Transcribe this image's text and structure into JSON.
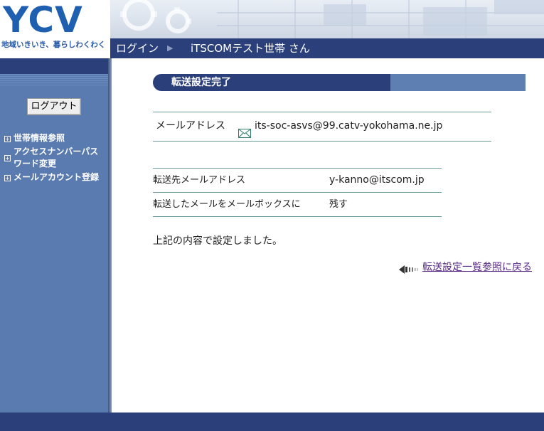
{
  "header": {
    "logo": "YCV",
    "tagline": "地域いきいき、暮らしわくわく",
    "login_label": "ログイン",
    "user_label": "iTSCOMテスト世帯 さん"
  },
  "sidebar": {
    "logout_label": "ログアウト",
    "items": [
      {
        "label": "世帯情報参照",
        "icon": "expand-box-icon"
      },
      {
        "label": "アクセスナンバーパスワード変更",
        "line1": "アクセスナンバーパス",
        "line2": "ワード変更",
        "icon": "expand-box-icon"
      },
      {
        "label": "メールアカウント登録",
        "icon": "expand-box-icon"
      }
    ]
  },
  "main": {
    "section_title": "転送設定完了",
    "mail_address_label": "メールアドレス",
    "mail_address_value": "its-soc-asvs@99.catv-yokohama.ne.jp",
    "settings": [
      {
        "key": "転送先メールアドレス",
        "value": "y-kanno@itscom.jp"
      },
      {
        "key": "転送したメールをメールボックスに",
        "value": "残す"
      }
    ],
    "result_message": "上記の内容で設定しました。",
    "back_link": "転送設定一覧参照に戻る"
  },
  "colors": {
    "navy": "#2b3f7a",
    "sidebar_blue": "#5a7bb0",
    "title_light": "#5d7fb2",
    "rule": "#6a9a9a",
    "link": "#5a2a86"
  }
}
